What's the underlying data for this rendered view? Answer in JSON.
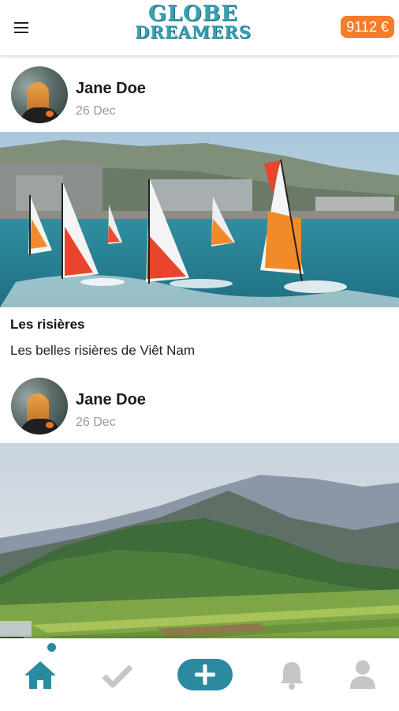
{
  "header": {
    "logo_line1": "GLOBE",
    "logo_line2": "DREAMERS",
    "balance": "9112 €"
  },
  "posts": [
    {
      "author": "Jane Doe",
      "date": "26 Dec",
      "title": "Les risières",
      "text": "Les belles risières de Viêt Nam"
    },
    {
      "author": "Jane Doe",
      "date": "26 Dec"
    }
  ],
  "nav": {
    "items": [
      "home-icon",
      "check-icon",
      "add-icon",
      "bell-icon",
      "user-icon"
    ],
    "active": "home",
    "accent_color": "#2a8ba0",
    "inactive_color": "#c6c6c6"
  }
}
